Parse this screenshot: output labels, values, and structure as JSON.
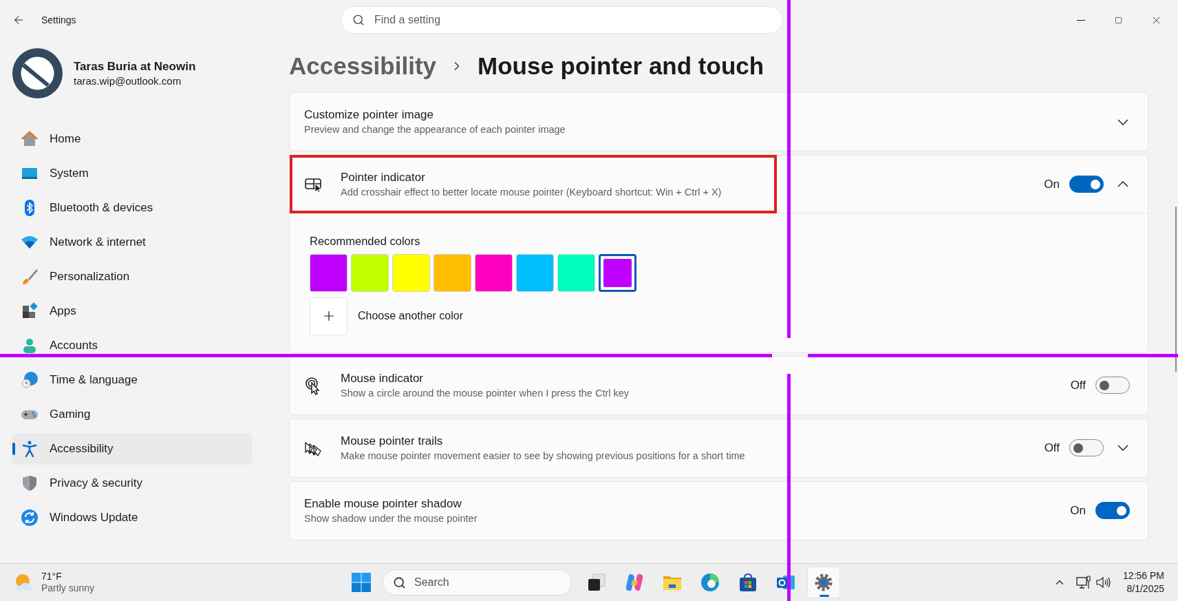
{
  "window": {
    "title": "Settings"
  },
  "search": {
    "placeholder": "Find a setting"
  },
  "profile": {
    "name": "Taras Buria at Neowin",
    "email": "taras.wip@outlook.com"
  },
  "sidebar": {
    "items": [
      {
        "label": "Home",
        "selected": false
      },
      {
        "label": "System",
        "selected": false
      },
      {
        "label": "Bluetooth & devices",
        "selected": false
      },
      {
        "label": "Network & internet",
        "selected": false
      },
      {
        "label": "Personalization",
        "selected": false
      },
      {
        "label": "Apps",
        "selected": false
      },
      {
        "label": "Accounts",
        "selected": false
      },
      {
        "label": "Time & language",
        "selected": false
      },
      {
        "label": "Gaming",
        "selected": false
      },
      {
        "label": "Accessibility",
        "selected": true
      },
      {
        "label": "Privacy & security",
        "selected": false
      },
      {
        "label": "Windows Update",
        "selected": false
      }
    ]
  },
  "breadcrumb": {
    "parent": "Accessibility",
    "current": "Mouse pointer and touch"
  },
  "settings": [
    {
      "title": "Customize pointer image",
      "description": "Preview and change the appearance of each pointer image",
      "highlighted": false,
      "expanded": false
    },
    {
      "title": "Pointer indicator",
      "description": "Add crosshair effect to better locate mouse pointer (Keyboard shortcut: Win + Ctrl + X)",
      "highlighted": true,
      "toggle": {
        "label": "On",
        "on": true
      },
      "expanded": true,
      "panel": {
        "heading": "Recommended colors",
        "swatches": [
          {
            "color": "#c000ff",
            "selected": false
          },
          {
            "color": "#bfff00",
            "selected": false
          },
          {
            "color": "#ffff00",
            "selected": false
          },
          {
            "color": "#ffbf00",
            "selected": false
          },
          {
            "color": "#ff00c0",
            "selected": false
          },
          {
            "color": "#00bfff",
            "selected": false
          },
          {
            "color": "#00ffbf",
            "selected": false
          },
          {
            "color": "#c000ff",
            "selected": true
          }
        ],
        "custom_label": "Choose another color"
      }
    },
    {
      "title": "Mouse indicator",
      "description": "Show a circle around the mouse pointer when I press the Ctrl key",
      "highlighted": false,
      "toggle": {
        "label": "Off",
        "on": false
      }
    },
    {
      "title": "Mouse pointer trails",
      "description": "Make mouse pointer movement easier to see by showing previous positions for a short time",
      "highlighted": false,
      "toggle": {
        "label": "Off",
        "on": false
      },
      "expanded": false
    },
    {
      "title": "Enable mouse pointer shadow",
      "description": "Show shadow under the mouse pointer",
      "highlighted": false,
      "toggle": {
        "label": "On",
        "on": true
      }
    }
  ],
  "taskbar": {
    "weather": {
      "temperature": "71°F",
      "condition": "Partly sunny"
    },
    "search": {
      "placeholder": "Search"
    },
    "apps": [
      {
        "selected": false
      },
      {
        "selected": false
      },
      {
        "selected": false
      },
      {
        "selected": false
      },
      {
        "selected": false
      },
      {
        "selected": false
      },
      {
        "selected": true
      }
    ],
    "clock": {
      "time": "12:56 PM",
      "date": "8/1/2025"
    }
  }
}
